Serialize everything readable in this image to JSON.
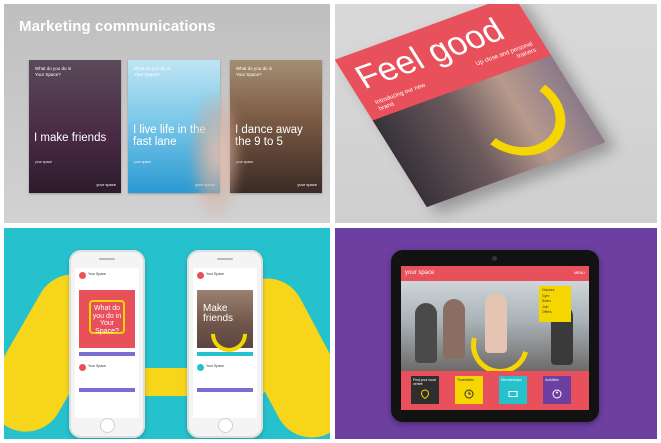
{
  "panel1": {
    "title": "Marketing communications",
    "posters": [
      {
        "question": "What do you do in Your Space?",
        "headline": "I make friends",
        "sub": "your space",
        "logo": "your space"
      },
      {
        "question": "What do you do in Your Space?",
        "headline": "I live life in the fast lane",
        "sub": "your space",
        "logo": "your space"
      },
      {
        "question": "What do you do in Your Space?",
        "headline": "I dance away the 9 to 5",
        "sub": "your space",
        "logo": "your space"
      }
    ]
  },
  "panel2": {
    "magazine_title": "Feel good",
    "side_text": "Up close and personal trainers",
    "left_text": "Introducing our new brand"
  },
  "panel3": {
    "post_user": "Your Space",
    "bubble_text": "What do you do in Your Space?",
    "photo_text": "Make friends"
  },
  "panel4": {
    "brand": "your space",
    "nav": "MENU",
    "menu_items": [
      "Classes",
      "Gym",
      "Swim",
      "Join",
      "Offers"
    ],
    "tiles": [
      {
        "label": "Find your local centre",
        "color": "#2e2e2e",
        "icon": "pin-icon"
      },
      {
        "label": "Timetables",
        "color": "#f5d600",
        "icon": "clock-icon"
      },
      {
        "label": "Memberships",
        "color": "#25c1cd",
        "icon": "card-icon"
      },
      {
        "label": "Activities",
        "color": "#6c3fa0",
        "icon": "person-icon"
      }
    ]
  },
  "colors": {
    "brand_red": "#e8505b",
    "brand_yellow": "#f5d600",
    "brand_teal": "#25c1cd",
    "brand_purple": "#6c3fa0"
  }
}
